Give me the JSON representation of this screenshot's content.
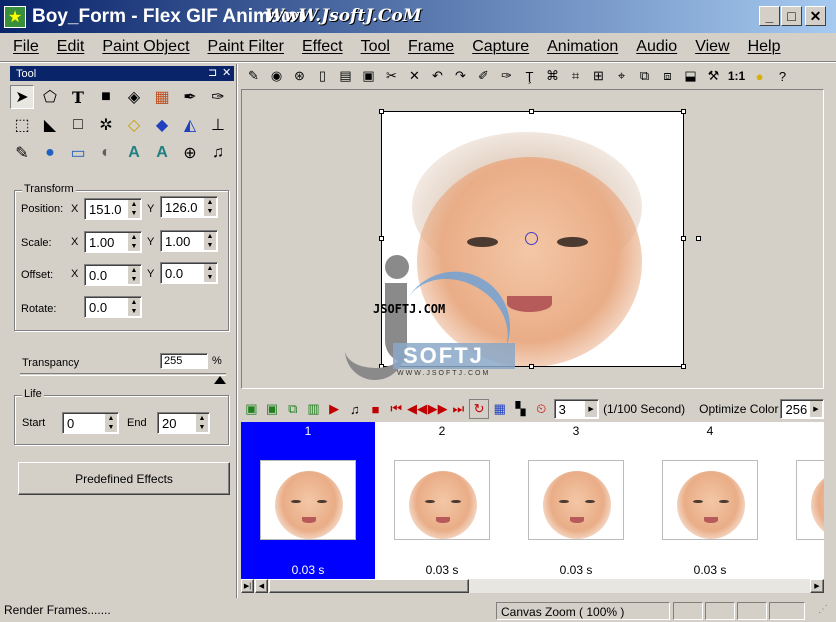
{
  "window": {
    "title": "Boy_Form - Flex GIF Animator",
    "watermark_title": "WwW.JsoftJ.CoM"
  },
  "menu": [
    "File",
    "Edit",
    "Paint Object",
    "Paint Filter",
    "Effect",
    "Tool",
    "Frame",
    "Capture",
    "Animation",
    "Audio",
    "View",
    "Help"
  ],
  "tool_panel": {
    "title": "Tool",
    "transform": {
      "label": "Transform",
      "position_label": "Position:",
      "position_x": "151.0",
      "position_y": "126.0",
      "scale_label": "Scale:",
      "scale_x": "1.00",
      "scale_y": "1.00",
      "offset_label": "Offset:",
      "offset_x": "0.0",
      "offset_y": "0.0",
      "rotate_label": "Rotate:",
      "rotate": "0.0",
      "x_label": "X",
      "y_label": "Y"
    },
    "transparency": {
      "label": "Transpancy",
      "value": "255",
      "unit": "%"
    },
    "life": {
      "label": "Life",
      "start_label": "Start",
      "start": "0",
      "end_label": "End",
      "end": "20"
    },
    "predefined_button": "Predefined Effects"
  },
  "canvas_toolbar": {
    "zoom_label": "1:1"
  },
  "watermark": {
    "brand": "JSOFTJ.COM",
    "logo_text": "SOFTJ",
    "url": "WWW.JSOFTJ.COM"
  },
  "anim_toolbar": {
    "delay": "3",
    "delay_unit": "(1/100 Second)",
    "optimize_label": "Optimize Color",
    "optimize_value": "256"
  },
  "frames": [
    {
      "num": "1",
      "duration": "0.03 s",
      "selected": true
    },
    {
      "num": "2",
      "duration": "0.03 s",
      "selected": false
    },
    {
      "num": "3",
      "duration": "0.03 s",
      "selected": false
    },
    {
      "num": "4",
      "duration": "0.03 s",
      "selected": false
    }
  ],
  "status": {
    "message": "Render Frames.......",
    "zoom": "Canvas Zoom ( 100% )"
  },
  "colors": {
    "title_start": "#0a246a",
    "title_end": "#a6caf0",
    "selected_frame": "#0000ff",
    "chrome": "#d4d0c8"
  }
}
